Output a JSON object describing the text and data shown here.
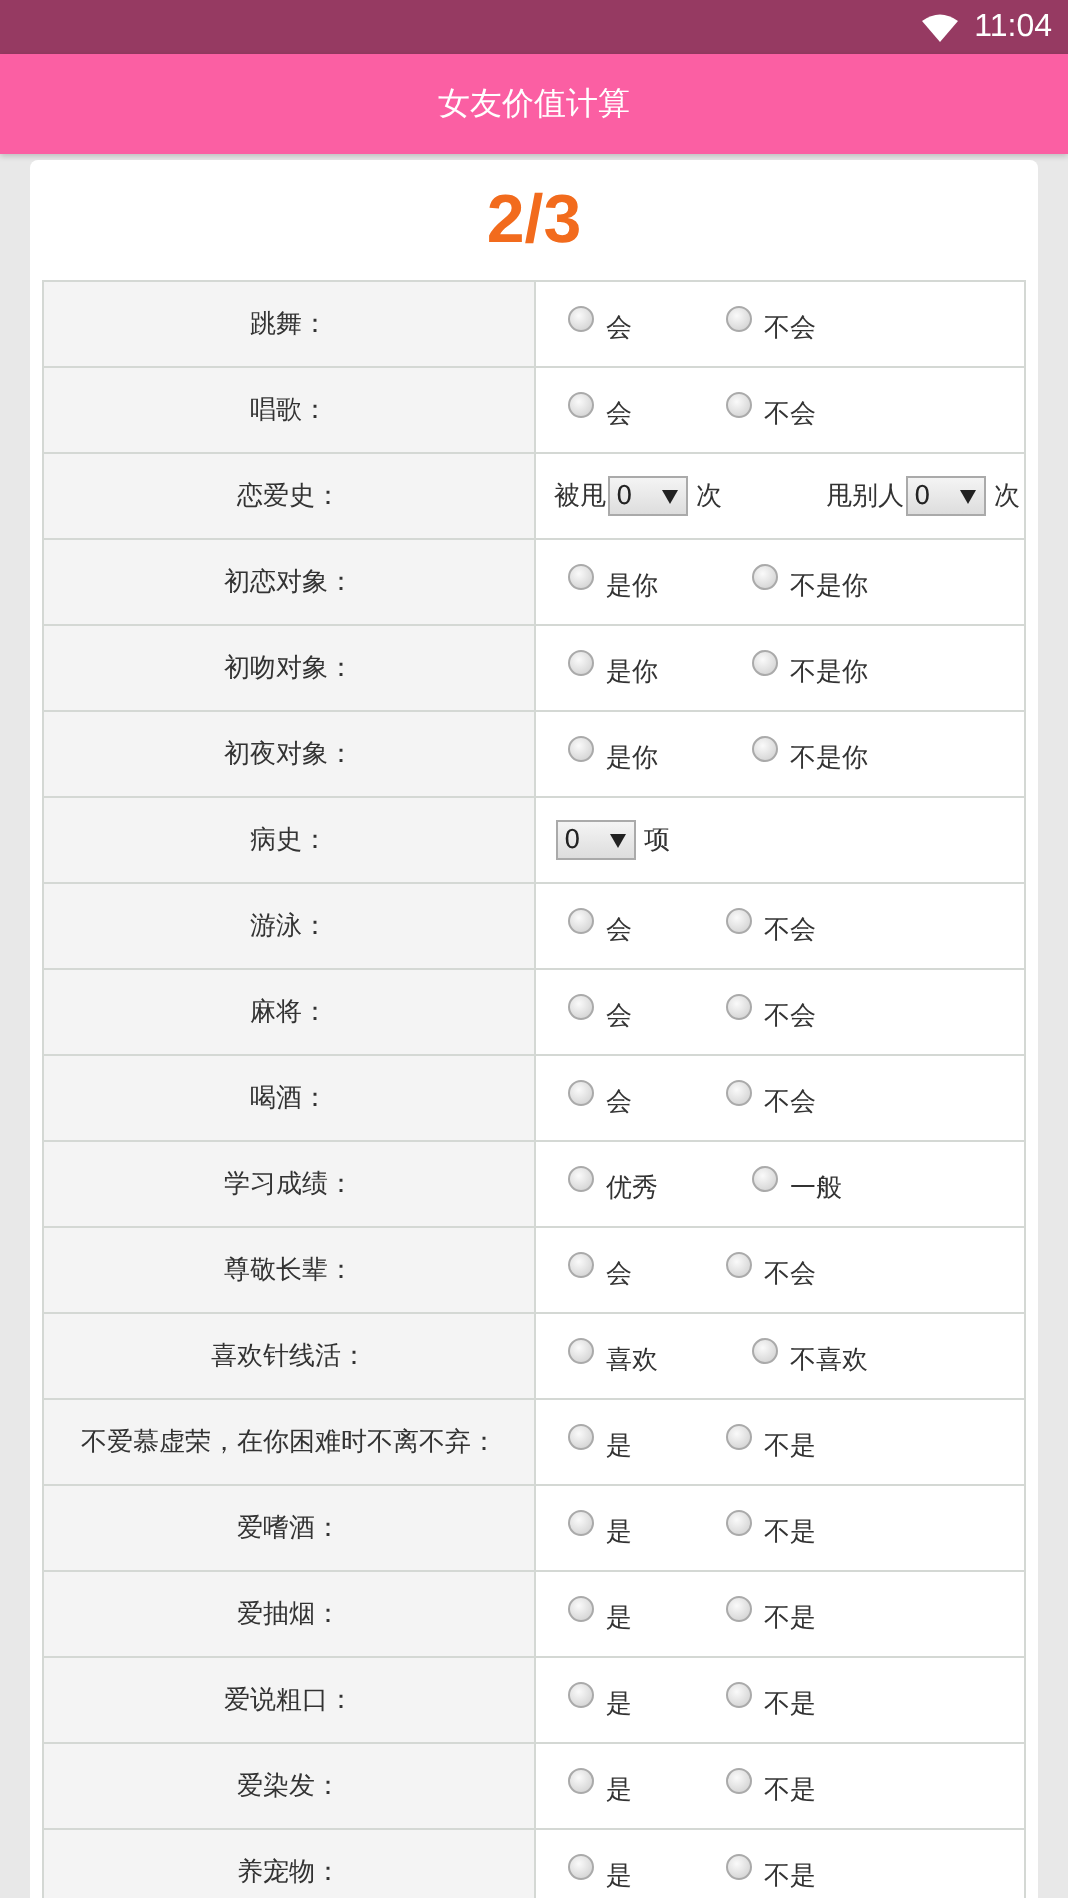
{
  "status_bar": {
    "time": "11:04"
  },
  "header": {
    "title": "女友价值计算"
  },
  "progress": "2/3",
  "rows": [
    {
      "label": "跳舞：",
      "kind": "radio",
      "options": [
        {
          "label": "会",
          "selected": false
        },
        {
          "label": "不会",
          "selected": false
        }
      ]
    },
    {
      "label": "唱歌：",
      "kind": "radio",
      "options": [
        {
          "label": "会",
          "selected": false
        },
        {
          "label": "不会",
          "selected": false
        }
      ]
    },
    {
      "label": "恋爱史：",
      "kind": "select",
      "fields": [
        {
          "prefix": "被甩",
          "value": "0",
          "suffix": "次"
        },
        {
          "prefix": "甩别人",
          "value": "0",
          "suffix": "次"
        }
      ]
    },
    {
      "label": "初恋对象：",
      "kind": "radio",
      "options": [
        {
          "label": "是你",
          "selected": false
        },
        {
          "label": "不是你",
          "selected": false
        }
      ]
    },
    {
      "label": "初吻对象：",
      "kind": "radio",
      "options": [
        {
          "label": "是你",
          "selected": false
        },
        {
          "label": "不是你",
          "selected": false
        }
      ]
    },
    {
      "label": "初夜对象：",
      "kind": "radio",
      "options": [
        {
          "label": "是你",
          "selected": false
        },
        {
          "label": "不是你",
          "selected": false
        }
      ]
    },
    {
      "label": "病史：",
      "kind": "select",
      "fields": [
        {
          "value": "0",
          "suffix": "项"
        }
      ]
    },
    {
      "label": "游泳：",
      "kind": "radio",
      "options": [
        {
          "label": "会",
          "selected": false
        },
        {
          "label": "不会",
          "selected": false
        }
      ]
    },
    {
      "label": "麻将：",
      "kind": "radio",
      "options": [
        {
          "label": "会",
          "selected": false
        },
        {
          "label": "不会",
          "selected": false
        }
      ]
    },
    {
      "label": "喝酒：",
      "kind": "radio",
      "options": [
        {
          "label": "会",
          "selected": false
        },
        {
          "label": "不会",
          "selected": false
        }
      ]
    },
    {
      "label": "学习成绩：",
      "kind": "radio",
      "options": [
        {
          "label": "优秀",
          "selected": false
        },
        {
          "label": "一般",
          "selected": false
        }
      ]
    },
    {
      "label": "尊敬长辈：",
      "kind": "radio",
      "options": [
        {
          "label": "会",
          "selected": false
        },
        {
          "label": "不会",
          "selected": false
        }
      ]
    },
    {
      "label": "喜欢针线活：",
      "kind": "radio",
      "options": [
        {
          "label": "喜欢",
          "selected": false
        },
        {
          "label": "不喜欢",
          "selected": false
        }
      ]
    },
    {
      "label": "不爱慕虚荣，在你困难时不离不弃：",
      "kind": "radio",
      "options": [
        {
          "label": "是",
          "selected": false
        },
        {
          "label": "不是",
          "selected": false
        }
      ]
    },
    {
      "label": "爱嗜酒：",
      "kind": "radio",
      "options": [
        {
          "label": "是",
          "selected": false
        },
        {
          "label": "不是",
          "selected": false
        }
      ]
    },
    {
      "label": "爱抽烟：",
      "kind": "radio",
      "options": [
        {
          "label": "是",
          "selected": false
        },
        {
          "label": "不是",
          "selected": false
        }
      ]
    },
    {
      "label": "爱说粗口：",
      "kind": "radio",
      "options": [
        {
          "label": "是",
          "selected": false
        },
        {
          "label": "不是",
          "selected": false
        }
      ]
    },
    {
      "label": "爱染发：",
      "kind": "radio",
      "options": [
        {
          "label": "是",
          "selected": false
        },
        {
          "label": "不是",
          "selected": false
        }
      ]
    },
    {
      "label": "养宠物：",
      "kind": "radio",
      "options": [
        {
          "label": "是",
          "selected": false
        },
        {
          "label": "不是",
          "selected": false
        }
      ]
    }
  ]
}
